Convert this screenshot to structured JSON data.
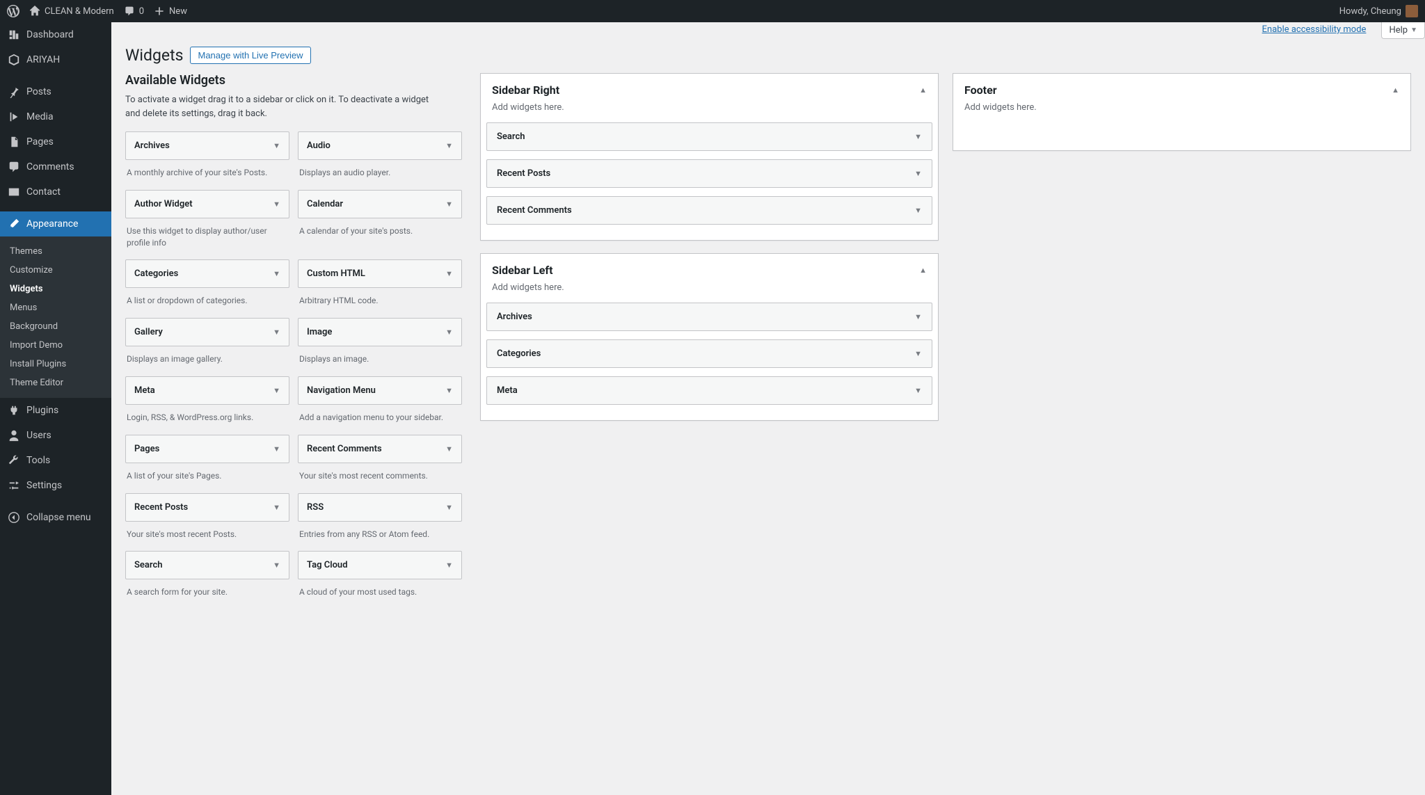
{
  "adminbar": {
    "site_name": "CLEAN & Modern",
    "comments_count": "0",
    "new_label": "New",
    "howdy": "Howdy, Cheung"
  },
  "menu": {
    "dashboard": "Dashboard",
    "ariyah": "ARIYAH",
    "posts": "Posts",
    "media": "Media",
    "pages": "Pages",
    "comments": "Comments",
    "contact": "Contact",
    "appearance": "Appearance",
    "plugins": "Plugins",
    "users": "Users",
    "tools": "Tools",
    "settings": "Settings",
    "collapse": "Collapse menu"
  },
  "submenu": {
    "themes": "Themes",
    "customize": "Customize",
    "widgets": "Widgets",
    "menus": "Menus",
    "background": "Background",
    "import_demo": "Import Demo",
    "install_plugins": "Install Plugins",
    "theme_editor": "Theme Editor"
  },
  "screen_meta": {
    "accessibility": "Enable accessibility mode",
    "help": "Help"
  },
  "page": {
    "title": "Widgets",
    "live_preview_btn": "Manage with Live Preview",
    "available_heading": "Available Widgets",
    "available_desc": "To activate a widget drag it to a sidebar or click on it. To deactivate a widget and delete its settings, drag it back."
  },
  "available_widgets": [
    {
      "name": "Archives",
      "desc": "A monthly archive of your site's Posts."
    },
    {
      "name": "Audio",
      "desc": "Displays an audio player."
    },
    {
      "name": "Author Widget",
      "desc": "Use this widget to display author/user profile info"
    },
    {
      "name": "Calendar",
      "desc": "A calendar of your site's posts."
    },
    {
      "name": "Categories",
      "desc": "A list or dropdown of categories."
    },
    {
      "name": "Custom HTML",
      "desc": "Arbitrary HTML code."
    },
    {
      "name": "Gallery",
      "desc": "Displays an image gallery."
    },
    {
      "name": "Image",
      "desc": "Displays an image."
    },
    {
      "name": "Meta",
      "desc": "Login, RSS, & WordPress.org links."
    },
    {
      "name": "Navigation Menu",
      "desc": "Add a navigation menu to your sidebar."
    },
    {
      "name": "Pages",
      "desc": "A list of your site's Pages."
    },
    {
      "name": "Recent Comments",
      "desc": "Your site's most recent comments."
    },
    {
      "name": "Recent Posts",
      "desc": "Your site's most recent Posts."
    },
    {
      "name": "RSS",
      "desc": "Entries from any RSS or Atom feed."
    },
    {
      "name": "Search",
      "desc": "A search form for your site."
    },
    {
      "name": "Tag Cloud",
      "desc": "A cloud of your most used tags."
    }
  ],
  "areas": {
    "sidebar_right": {
      "title": "Sidebar Right",
      "desc": "Add widgets here.",
      "widgets": [
        "Search",
        "Recent Posts",
        "Recent Comments"
      ]
    },
    "sidebar_left": {
      "title": "Sidebar Left",
      "desc": "Add widgets here.",
      "widgets": [
        "Archives",
        "Categories",
        "Meta"
      ]
    },
    "footer": {
      "title": "Footer",
      "desc": "Add widgets here.",
      "widgets": []
    }
  }
}
